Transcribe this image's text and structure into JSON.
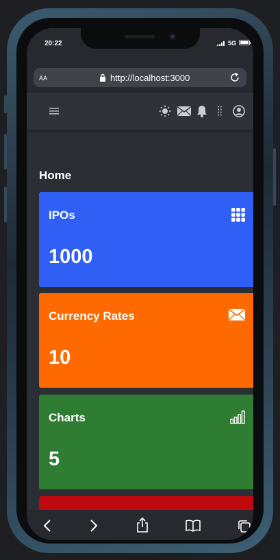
{
  "status_bar": {
    "time": "20:22",
    "network": "5G"
  },
  "browser": {
    "text_size_label": "AA",
    "url": "http://localhost:3000"
  },
  "page": {
    "title": "Home"
  },
  "cards": [
    {
      "title": "IPOs",
      "value": "1000",
      "color": "#2f5ff5",
      "icon": "grid-icon"
    },
    {
      "title": "Currency Rates",
      "value": "10",
      "color": "#ff6a00",
      "icon": "envelope-icon"
    },
    {
      "title": "Charts",
      "value": "5",
      "color": "#2e7d32",
      "icon": "bar-chart-icon"
    }
  ],
  "colors": {
    "background": "#2b2f35",
    "navbar": "#2f3338",
    "card_red_partial": "#c0090f"
  }
}
